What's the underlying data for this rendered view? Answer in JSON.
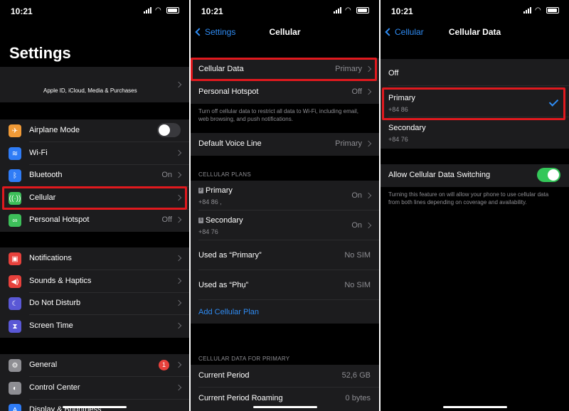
{
  "status": {
    "time": "10:21"
  },
  "panel1": {
    "title": "Settings",
    "account": "Apple ID, iCloud, Media & Purchases",
    "items": [
      {
        "label": "Airplane Mode",
        "value": ""
      },
      {
        "label": "Wi-Fi",
        "value": ""
      },
      {
        "label": "Bluetooth",
        "value": "On"
      },
      {
        "label": "Cellular",
        "value": ""
      },
      {
        "label": "Personal Hotspot",
        "value": "Off"
      },
      {
        "label": "Notifications",
        "value": ""
      },
      {
        "label": "Sounds & Haptics",
        "value": ""
      },
      {
        "label": "Do Not Disturb",
        "value": ""
      },
      {
        "label": "Screen Time",
        "value": ""
      },
      {
        "label": "General",
        "value": "",
        "badge": "1"
      },
      {
        "label": "Control Center",
        "value": ""
      },
      {
        "label": "Display & Brightness",
        "value": ""
      }
    ],
    "colors": {
      "airplane": "#f09a37",
      "wifi": "#2f7cf6",
      "bluetooth": "#2f7cf6",
      "cellular": "#3dbf5a",
      "hotspot": "#3dbf5a",
      "notifications": "#e7413c",
      "sounds": "#e7413c",
      "dnd": "#5a58d6",
      "screentime": "#5a58d6",
      "general": "#8e8e93",
      "control": "#8e8e93",
      "display": "#2f7cf6"
    }
  },
  "panel2": {
    "back": "Settings",
    "title": "Cellular",
    "cellular_data": {
      "label": "Cellular Data",
      "value": "Primary"
    },
    "hotspot": {
      "label": "Personal Hotspot",
      "value": "Off"
    },
    "footer": "Turn off cellular data to restrict all data to Wi-Fi, including email, web browsing, and push notifications.",
    "voice": {
      "label": "Default Voice Line",
      "value": "Primary"
    },
    "plans_header": "CELLULAR PLANS",
    "plans": [
      {
        "tag": "P",
        "label": "Primary",
        "number": "+84 86 ,",
        "value": "On"
      },
      {
        "tag": "S",
        "label": "Secondary",
        "number": "+84 76",
        "value": "On"
      }
    ],
    "used": [
      {
        "label": "Used as “Primary”",
        "value": "No SIM"
      },
      {
        "label": "Used as “Phụ”",
        "value": "No SIM"
      }
    ],
    "add_plan": "Add Cellular Plan",
    "data_header": "CELLULAR DATA FOR PRIMARY",
    "period": {
      "label": "Current Period",
      "value": "52,6 GB"
    },
    "roaming": {
      "label": "Current Period Roaming",
      "value": "0 bytes"
    }
  },
  "panel3": {
    "back": "Cellular",
    "title": "Cellular Data",
    "off": "Off",
    "primary": {
      "label": "Primary",
      "number": "+84 86"
    },
    "secondary": {
      "label": "Secondary",
      "number": "+84 76"
    },
    "switching": {
      "label": "Allow Cellular Data Switching",
      "state": "on"
    },
    "footer": "Turning this feature on will allow your phone to use cellular data from both lines depending on coverage and availability."
  }
}
